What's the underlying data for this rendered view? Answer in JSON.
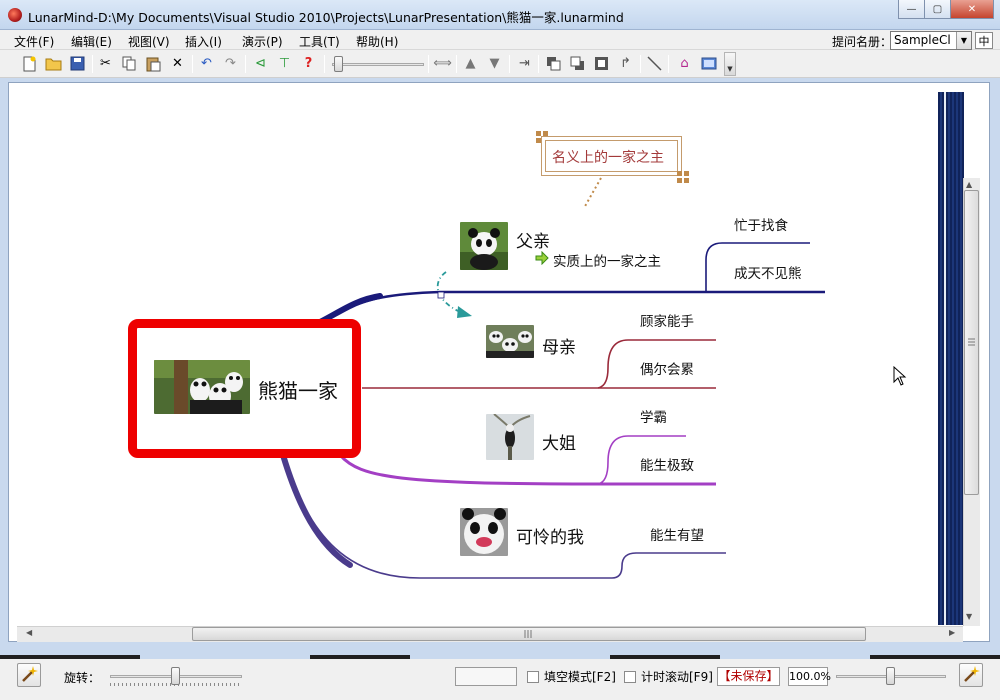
{
  "window": {
    "title": "LunarMind-D:\\My Documents\\Visual Studio 2010\\Projects\\LunarPresentation\\熊猫一家.lunarmind",
    "minimize": "—",
    "maximize": "▢",
    "close": "✕"
  },
  "menu": {
    "items": [
      "文件(F)",
      "编辑(E)",
      "视图(V)",
      "插入(I)",
      "演示(P)",
      "工具(T)",
      "帮助(H)"
    ],
    "prompt_label": "提问名册：",
    "prompt_value": "SampleCl"
  },
  "mindmap": {
    "root": "熊猫一家",
    "callout": "名义上的一家之主",
    "branches": [
      {
        "label": "父亲",
        "note": "实质上的一家之主",
        "children": [
          "忙于找食",
          "成天不见熊"
        ]
      },
      {
        "label": "母亲",
        "children": [
          "顾家能手",
          "偶尔会累"
        ]
      },
      {
        "label": "大姐",
        "children": [
          "学霸",
          "能生极致"
        ]
      },
      {
        "label": "可怜的我",
        "children": [
          "能生有望"
        ]
      }
    ]
  },
  "status": {
    "rotate_label": "旋转：",
    "hollow_mode": "填空模式[F2]",
    "timed_scroll": "计时滚动[F9]",
    "unsaved": "【未保存】",
    "zoom": "100.0%"
  },
  "colors": {
    "root_border": "#ee0000",
    "father_branch": "#1a1a7a",
    "mother_branch": "#9a2a3a",
    "sister_branch": "#a33fc4",
    "me_branch": "#4a3b8c",
    "callout_text": "#a33a3a",
    "unsaved_text": "#b00000"
  }
}
